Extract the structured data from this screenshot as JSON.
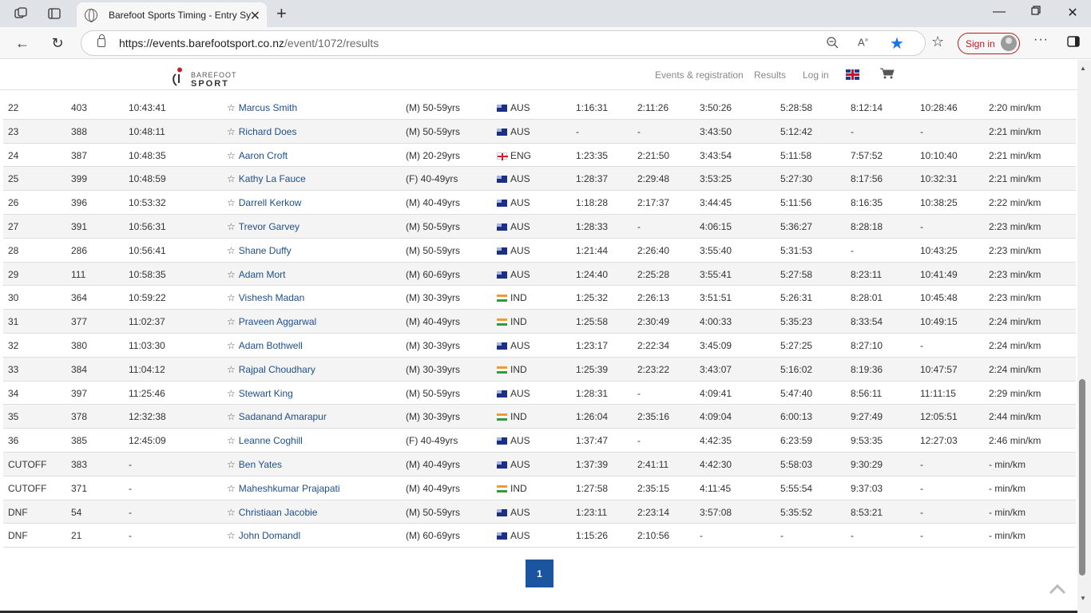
{
  "browser": {
    "tab_title": "Barefoot Sports Timing - Entry Sy",
    "url_host": "https://events.barefootsport.co.nz",
    "url_path": "/event/1072/results",
    "sign_in_label": "Sign in"
  },
  "site": {
    "logo_line1": "BAREFOOT",
    "logo_line2": "SPORT",
    "nav": [
      "Events & registration",
      "Results",
      "Log in"
    ]
  },
  "results": [
    [
      "22",
      "403",
      "10:43:41",
      "Marcus Smith",
      "(M) 50-59yrs",
      "aus",
      "AUS",
      "1:16:31",
      "2:11:26",
      "3:50:26",
      "5:28:58",
      "8:12:14",
      "10:28:46",
      "2:20 min/km"
    ],
    [
      "23",
      "388",
      "10:48:11",
      "Richard Does",
      "(M) 50-59yrs",
      "aus",
      "AUS",
      "-",
      "-",
      "3:43:50",
      "5:12:42",
      "-",
      "-",
      "2:21 min/km"
    ],
    [
      "24",
      "387",
      "10:48:35",
      "Aaron Croft",
      "(M) 20-29yrs",
      "eng",
      "ENG",
      "1:23:35",
      "2:21:50",
      "3:43:54",
      "5:11:58",
      "7:57:52",
      "10:10:40",
      "2:21 min/km"
    ],
    [
      "25",
      "399",
      "10:48:59",
      "Kathy La Fauce",
      "(F) 40-49yrs",
      "aus",
      "AUS",
      "1:28:37",
      "2:29:48",
      "3:53:25",
      "5:27:30",
      "8:17:56",
      "10:32:31",
      "2:21 min/km"
    ],
    [
      "26",
      "396",
      "10:53:32",
      "Darrell Kerkow",
      "(M) 40-49yrs",
      "aus",
      "AUS",
      "1:18:28",
      "2:17:37",
      "3:44:45",
      "5:11:56",
      "8:16:35",
      "10:38:25",
      "2:22 min/km"
    ],
    [
      "27",
      "391",
      "10:56:31",
      "Trevor Garvey",
      "(M) 50-59yrs",
      "aus",
      "AUS",
      "1:28:33",
      "-",
      "4:06:15",
      "5:36:27",
      "8:28:18",
      "-",
      "2:23 min/km"
    ],
    [
      "28",
      "286",
      "10:56:41",
      "Shane Duffy",
      "(M) 50-59yrs",
      "aus",
      "AUS",
      "1:21:44",
      "2:26:40",
      "3:55:40",
      "5:31:53",
      "-",
      "10:43:25",
      "2:23 min/km"
    ],
    [
      "29",
      "111",
      "10:58:35",
      "Adam Mort",
      "(M) 60-69yrs",
      "aus",
      "AUS",
      "1:24:40",
      "2:25:28",
      "3:55:41",
      "5:27:58",
      "8:23:11",
      "10:41:49",
      "2:23 min/km"
    ],
    [
      "30",
      "364",
      "10:59:22",
      "Vishesh Madan",
      "(M) 30-39yrs",
      "ind",
      "IND",
      "1:25:32",
      "2:26:13",
      "3:51:51",
      "5:26:31",
      "8:28:01",
      "10:45:48",
      "2:23 min/km"
    ],
    [
      "31",
      "377",
      "11:02:37",
      "Praveen Aggarwal",
      "(M) 40-49yrs",
      "ind",
      "IND",
      "1:25:58",
      "2:30:49",
      "4:00:33",
      "5:35:23",
      "8:33:54",
      "10:49:15",
      "2:24 min/km"
    ],
    [
      "32",
      "380",
      "11:03:30",
      "Adam Bothwell",
      "(M) 30-39yrs",
      "aus",
      "AUS",
      "1:23:17",
      "2:22:34",
      "3:45:09",
      "5:27:25",
      "8:27:10",
      "-",
      "2:24 min/km"
    ],
    [
      "33",
      "384",
      "11:04:12",
      "Rajpal Choudhary",
      "(M) 30-39yrs",
      "ind",
      "IND",
      "1:25:39",
      "2:23:22",
      "3:43:07",
      "5:16:02",
      "8:19:36",
      "10:47:57",
      "2:24 min/km"
    ],
    [
      "34",
      "397",
      "11:25:46",
      "Stewart King",
      "(M) 50-59yrs",
      "aus",
      "AUS",
      "1:28:31",
      "-",
      "4:09:41",
      "5:47:40",
      "8:56:11",
      "11:11:15",
      "2:29 min/km"
    ],
    [
      "35",
      "378",
      "12:32:38",
      "Sadanand Amarapur",
      "(M) 30-39yrs",
      "ind",
      "IND",
      "1:26:04",
      "2:35:16",
      "4:09:04",
      "6:00:13",
      "9:27:49",
      "12:05:51",
      "2:44 min/km"
    ],
    [
      "36",
      "385",
      "12:45:09",
      "Leanne Coghill",
      "(F) 40-49yrs",
      "aus",
      "AUS",
      "1:37:47",
      "-",
      "4:42:35",
      "6:23:59",
      "9:53:35",
      "12:27:03",
      "2:46 min/km"
    ],
    [
      "CUTOFF",
      "383",
      "-",
      "Ben Yates",
      "(M) 40-49yrs",
      "aus",
      "AUS",
      "1:37:39",
      "2:41:11",
      "4:42:30",
      "5:58:03",
      "9:30:29",
      "-",
      "- min/km"
    ],
    [
      "CUTOFF",
      "371",
      "-",
      "Maheshkumar Prajapati",
      "(M) 40-49yrs",
      "ind",
      "IND",
      "1:27:58",
      "2:35:15",
      "4:11:45",
      "5:55:54",
      "9:37:03",
      "-",
      "- min/km"
    ],
    [
      "DNF",
      "54",
      "-",
      "Christiaan Jacobie",
      "(M) 50-59yrs",
      "aus",
      "AUS",
      "1:23:11",
      "2:23:14",
      "3:57:08",
      "5:35:52",
      "8:53:21",
      "-",
      "- min/km"
    ],
    [
      "DNF",
      "21",
      "-",
      "John Domandl",
      "(M) 60-69yrs",
      "aus",
      "AUS",
      "1:15:26",
      "2:10:56",
      "-",
      "-",
      "-",
      "-",
      "- min/km"
    ]
  ],
  "pagination": {
    "current": "1"
  }
}
